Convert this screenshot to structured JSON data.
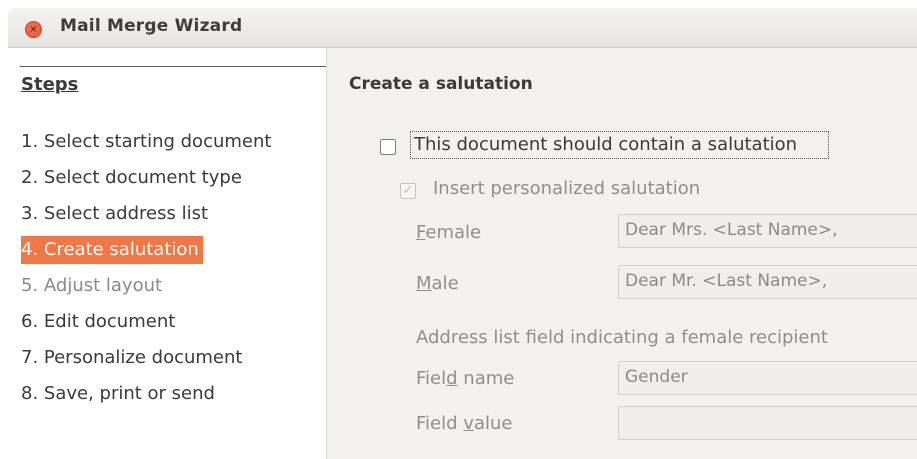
{
  "window": {
    "title": "Mail Merge Wizard"
  },
  "sidebar": {
    "heading": "Steps",
    "steps": [
      {
        "label": "1. Select starting document",
        "state": "normal"
      },
      {
        "label": "2. Select document type",
        "state": "normal"
      },
      {
        "label": "3. Select address list",
        "state": "normal"
      },
      {
        "label": "4. Create salutation",
        "state": "current"
      },
      {
        "label": "5. Adjust layout",
        "state": "disabled"
      },
      {
        "label": "6. Edit document",
        "state": "normal"
      },
      {
        "label": "7. Personalize document",
        "state": "normal"
      },
      {
        "label": "8. Save, print or send",
        "state": "normal"
      }
    ]
  },
  "main": {
    "title": "Create a salutation",
    "contain_salutation": {
      "label": "This document should contain a salutation",
      "checked": false
    },
    "personalized": {
      "label": "Insert personalized salutation",
      "checked": true,
      "enabled": false
    },
    "female": {
      "label_pre": "",
      "label_mn": "F",
      "label_post": "emale",
      "value": "Dear Mrs. <Last Name>,"
    },
    "male": {
      "label_pre": "",
      "label_mn": "M",
      "label_post": "ale",
      "value": "Dear Mr. <Last Name>,"
    },
    "female_recipient_caption": "Address list field indicating a female recipient",
    "field_name": {
      "label_pre": "Fiel",
      "label_mn": "d",
      "label_post": " name",
      "value": "Gender"
    },
    "field_value": {
      "label_pre": "Field ",
      "label_mn": "v",
      "label_post": "alue",
      "value": ""
    }
  }
}
